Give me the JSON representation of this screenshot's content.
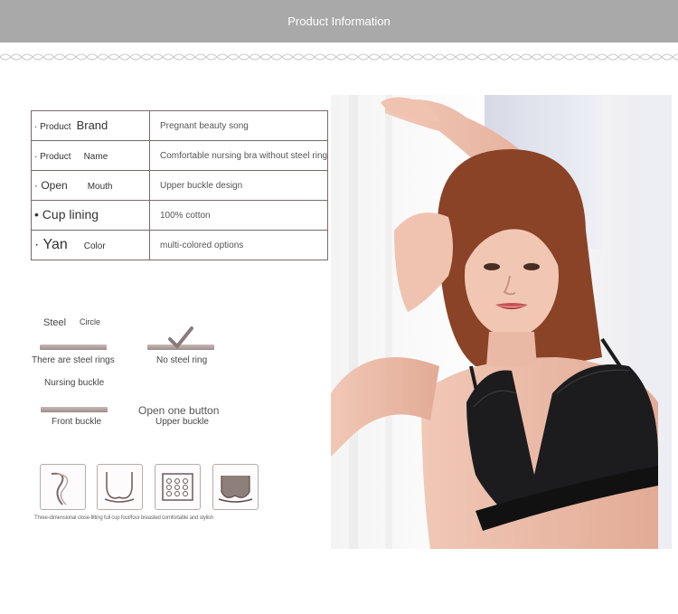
{
  "header": {
    "title": "Product Information"
  },
  "specs": [
    {
      "label_a": "· Product",
      "label_b": "Brand",
      "value": "Pregnant beauty song"
    },
    {
      "label_a": "· Product",
      "label_b": "Name",
      "value": "Comfortable nursing bra without steel ring"
    },
    {
      "label_a": "· Open",
      "label_b": "Mouth",
      "value": "Upper buckle design"
    },
    {
      "label_a": "•  Cup lining",
      "label_b": "",
      "value": "100% cotton"
    },
    {
      "label_a": "· Yan",
      "label_b": "Color",
      "value": "multi-colored options"
    }
  ],
  "steel": {
    "title_a": "Steel",
    "title_b": "Circle",
    "option_1": "There are steel rings",
    "option_2": "No steel ring"
  },
  "nursing": {
    "title": "Nursing buckle",
    "option_1": "Front buckle",
    "option_2_title": "Open one button",
    "option_2": "Upper buckle"
  },
  "features": {
    "icons": [
      "curve-cup-icon",
      "full-cup-bra-icon",
      "hook-eye-fastener-icon",
      "lace-bra-icon"
    ],
    "caption": "Three-dimensional close-fitting full cup four/four breasted comfortable and stylish"
  },
  "colors": {
    "header_bg": "#a9a9a9",
    "bar": "#a89898",
    "bra": "#1c1c1e",
    "skin": "#e9b9a6",
    "hair": "#8a4326"
  }
}
